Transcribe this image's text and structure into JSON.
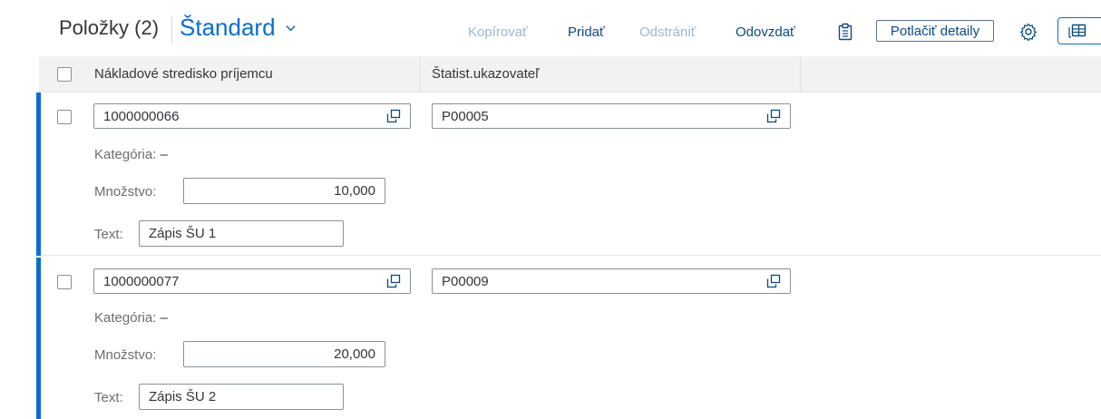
{
  "toolbar": {
    "title": "Položky (2)",
    "variant": "Štandard",
    "actions": {
      "copy": "Kopírovať",
      "add": "Pridať",
      "remove": "Odstrániť",
      "submit": "Odovzdať",
      "suppress_details": "Potlačiť detaily"
    },
    "icons": {
      "paste": "paste-icon",
      "settings": "gear-icon",
      "export": "table-export-icon",
      "chevron": "chevron-down-icon"
    },
    "colors": {
      "accent": "#0a6ed1",
      "action_enabled": "#0a4a87",
      "action_disabled": "#9fb6cc"
    }
  },
  "table": {
    "columns": [
      "Nákladové stredisko príjemcu",
      "Štatist.ukazovateľ"
    ],
    "items": [
      {
        "cost_center": "1000000066",
        "stat_indicator": "P00005",
        "category_label": "Kategória:",
        "category_value": "–",
        "quantity_label": "Množstvo:",
        "quantity_value": "10,000",
        "text_label": "Text:",
        "text_value": "Zápis ŠU 1"
      },
      {
        "cost_center": "1000000077",
        "stat_indicator": "P00009",
        "category_label": "Kategória:",
        "category_value": "–",
        "quantity_label": "Množstvo:",
        "quantity_value": "20,000",
        "text_label": "Text:",
        "text_value": "Zápis ŠU 2"
      }
    ]
  }
}
